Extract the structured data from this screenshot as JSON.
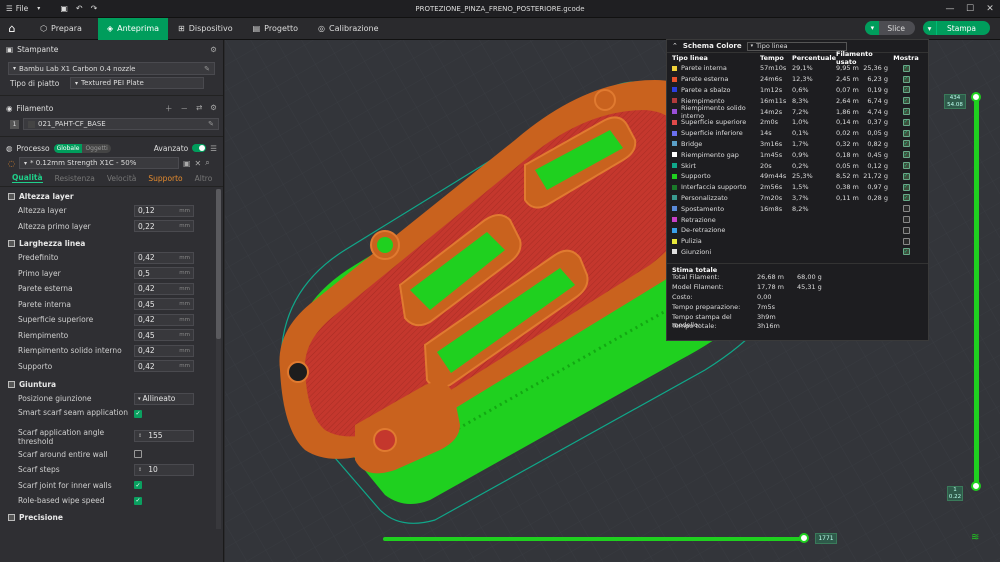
{
  "titlebar": {
    "menu_label": "File",
    "filename": "PROTEZIONE_PINZA_FRENO_POSTERIORE.gcode"
  },
  "nav": {
    "tabs": [
      {
        "label": "Prepara"
      },
      {
        "label": "Anteprima"
      },
      {
        "label": "Dispositivo"
      },
      {
        "label": "Progetto"
      },
      {
        "label": "Calibrazione"
      }
    ],
    "slice_label": "Slice",
    "print_label": "Stampa"
  },
  "printer": {
    "section_title": "Stampante",
    "name": "Bambu Lab X1 Carbon 0.4 nozzle",
    "plate_label": "Tipo di piatto",
    "plate_value": "Textured PEI Plate"
  },
  "filament": {
    "section_title": "Filamento",
    "index": "1",
    "name": "021_PAHT-CF_BASE"
  },
  "process": {
    "section_title": "Processo",
    "toggle_global": "Globale",
    "toggle_object": "Oggetti",
    "advanced_label": "Avanzato",
    "preset": "* 0.12mm Strength X1C - 50%",
    "subtabs": [
      "Qualità",
      "Resistenza",
      "Velocità",
      "Supporto",
      "Altro"
    ]
  },
  "groups": {
    "layer_height": {
      "title": "Altezza layer",
      "rows": [
        {
          "label": "Altezza layer",
          "value": "0,12",
          "unit": "mm"
        },
        {
          "label": "Altezza primo layer",
          "value": "0,22",
          "unit": "mm"
        }
      ]
    },
    "line_width": {
      "title": "Larghezza linea",
      "rows": [
        {
          "label": "Predefinito",
          "value": "0,42",
          "unit": "mm"
        },
        {
          "label": "Primo layer",
          "value": "0,5",
          "unit": "mm"
        },
        {
          "label": "Parete esterna",
          "value": "0,42",
          "unit": "mm"
        },
        {
          "label": "Parete interna",
          "value": "0,45",
          "unit": "mm"
        },
        {
          "label": "Superficie superiore",
          "value": "0,42",
          "unit": "mm"
        },
        {
          "label": "Riempimento",
          "value": "0,45",
          "unit": "mm"
        },
        {
          "label": "Riempimento solido interno",
          "value": "0,42",
          "unit": "mm"
        },
        {
          "label": "Supporto",
          "value": "0,42",
          "unit": "mm"
        }
      ]
    },
    "seam": {
      "title": "Giuntura",
      "position_label": "Posizione giunzione",
      "position_value": "Allineato",
      "smart_scarf_label": "Smart scarf seam application",
      "angle_label": "Scarf application angle threshold",
      "angle_value": "155",
      "around_wall_label": "Scarf around entire wall",
      "steps_label": "Scarf steps",
      "steps_value": "10",
      "inner_walls_label": "Scarf joint for inner walls",
      "wipe_label": "Role-based wipe speed"
    },
    "precision": {
      "title": "Precisione"
    }
  },
  "legend": {
    "title": "Schema Colore",
    "selector": "Tipo linea",
    "headers": [
      "Tipo linea",
      "Tempo",
      "Percentuale",
      "Filamento usato",
      "Mostra"
    ],
    "rows": [
      {
        "name": "Parete interna",
        "color": "#f0d23a",
        "time": "57m10s",
        "pct": "29,1%",
        "len": "9,95 m",
        "wt": "25,36 g",
        "show": true
      },
      {
        "name": "Parete esterna",
        "color": "#e8522d",
        "time": "24m6s",
        "pct": "12,3%",
        "len": "2,45 m",
        "wt": "6,23 g",
        "show": true
      },
      {
        "name": "Parete a sbalzo",
        "color": "#2a3fe0",
        "time": "1m12s",
        "pct": "0,6%",
        "len": "0,07 m",
        "wt": "0,19 g",
        "show": true
      },
      {
        "name": "Riempimento",
        "color": "#b23a3a",
        "time": "16m11s",
        "pct": "8,3%",
        "len": "2,64 m",
        "wt": "6,74 g",
        "show": true
      },
      {
        "name": "Riempimento solido interno",
        "color": "#9a4fd8",
        "time": "14m2s",
        "pct": "7,2%",
        "len": "1,86 m",
        "wt": "4,74 g",
        "show": true
      },
      {
        "name": "Superficie superiore",
        "color": "#e04a4a",
        "time": "2m0s",
        "pct": "1,0%",
        "len": "0,14 m",
        "wt": "0,37 g",
        "show": true
      },
      {
        "name": "Superficie inferiore",
        "color": "#6b6ff0",
        "time": "14s",
        "pct": "0,1%",
        "len": "0,02 m",
        "wt": "0,05 g",
        "show": true
      },
      {
        "name": "Bridge",
        "color": "#5aa0c8",
        "time": "3m16s",
        "pct": "1,7%",
        "len": "0,32 m",
        "wt": "0,82 g",
        "show": true
      },
      {
        "name": "Riempimento gap",
        "color": "#ffffff",
        "time": "1m45s",
        "pct": "0,9%",
        "len": "0,18 m",
        "wt": "0,45 g",
        "show": true
      },
      {
        "name": "Skirt",
        "color": "#0fa88a",
        "time": "20s",
        "pct": "0,2%",
        "len": "0,05 m",
        "wt": "0,12 g",
        "show": true
      },
      {
        "name": "Supporto",
        "color": "#1fd01f",
        "time": "49m44s",
        "pct": "25,3%",
        "len": "8,52 m",
        "wt": "21,72 g",
        "show": true
      },
      {
        "name": "Interfaccia supporto",
        "color": "#1a7a2a",
        "time": "2m56s",
        "pct": "1,5%",
        "len": "0,38 m",
        "wt": "0,97 g",
        "show": true
      },
      {
        "name": "Personalizzato",
        "color": "#3a9a90",
        "time": "7m20s",
        "pct": "3,7%",
        "len": "0,11 m",
        "wt": "0,28 g",
        "show": true
      },
      {
        "name": "Spostamento",
        "color": "#5a8ad8",
        "time": "16m8s",
        "pct": "8,2%",
        "len": "",
        "wt": "",
        "show": false
      },
      {
        "name": "Retrazione",
        "color": "#c840c8",
        "time": "",
        "pct": "",
        "len": "",
        "wt": "",
        "show": false
      },
      {
        "name": "De-retrazione",
        "color": "#3aa0e8",
        "time": "",
        "pct": "",
        "len": "",
        "wt": "",
        "show": false
      },
      {
        "name": "Pulizia",
        "color": "#e8e83a",
        "time": "",
        "pct": "",
        "len": "",
        "wt": "",
        "show": false
      },
      {
        "name": "Giunzioni",
        "color": "#e0e0e0",
        "time": "",
        "pct": "",
        "len": "",
        "wt": "",
        "show": true
      }
    ],
    "summary_title": "Stima totale",
    "summary": [
      {
        "k": "Total Filament:",
        "v1": "26,68 m",
        "v2": "68,00 g"
      },
      {
        "k": "Model Filament:",
        "v1": "17,78 m",
        "v2": "45,31 g"
      },
      {
        "k": "Costo:",
        "v1": "0,00",
        "v2": ""
      },
      {
        "k": "Tempo preparazione:",
        "v1": "7m5s",
        "v2": ""
      },
      {
        "k": "Tempo stampa del modello:",
        "v1": "3h9m",
        "v2": ""
      },
      {
        "k": "Tempo totale:",
        "v1": "3h16m",
        "v2": ""
      }
    ]
  },
  "sliders": {
    "layer_top": "434",
    "layer_top_height": "54.08",
    "layer_bottom": "1",
    "layer_bottom_height": "0.22",
    "move_value": "1771"
  },
  "colors": {
    "accent": "#009d5c",
    "model_orange": "#c9621e",
    "model_red": "#c4372d",
    "support_green": "#1fd01f"
  }
}
